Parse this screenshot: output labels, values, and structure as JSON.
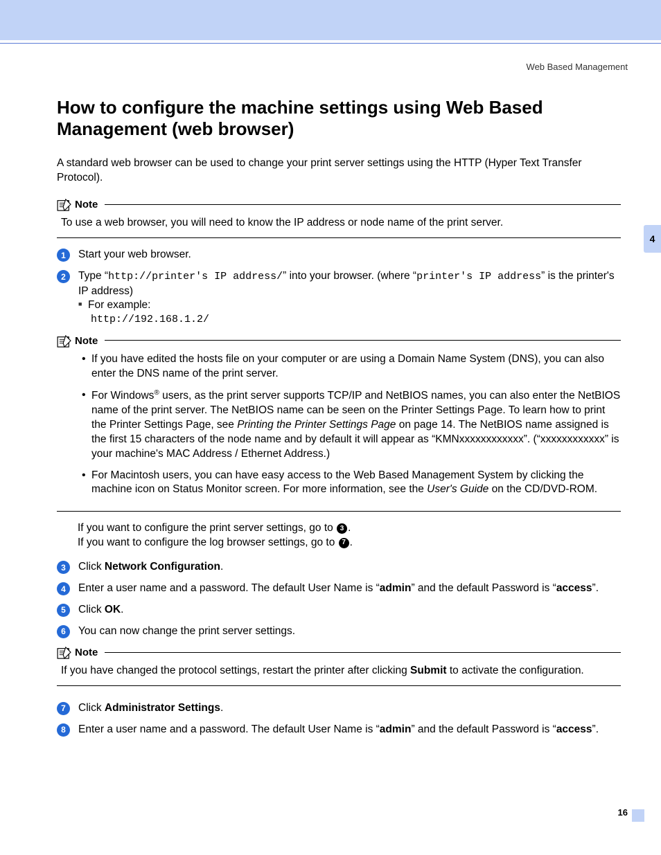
{
  "header_label": "Web Based Management",
  "chapter_tab": "4",
  "page_number": "16",
  "title": "How to configure the machine settings using Web Based Management (web browser)",
  "intro": "A standard web browser can be used to change your print server settings using the HTTP (Hyper Text Transfer Protocol).",
  "note_label": "Note",
  "note1": "To use a web browser, you will need to know the IP address or node name of the print server.",
  "step1": "Start your web browser.",
  "step2_a": "Type “",
  "step2_code1": "http://printer's IP address/",
  "step2_b": "” into your browser. (where “",
  "step2_code2": "printer's IP address",
  "step2_c": "” is the printer's IP address)",
  "step2_example_label": "For example:",
  "step2_example_code": "http://192.168.1.2/",
  "note2_b1": "If you have edited the hosts file on your computer or are using a Domain Name System (DNS), you can also enter the DNS name of the print server.",
  "note2_b2_a": "For Windows",
  "note2_b2_b": " users, as the print server supports TCP/IP and NetBIOS names, you can also enter the NetBIOS name of the print server. The NetBIOS name can be seen on the Printer Settings Page. To learn how to print the Printer Settings Page, see ",
  "note2_b2_italic": "Printing the Printer Settings Page",
  "note2_b2_c": " on page 14. The NetBIOS name assigned is the first 15 characters of the node name and by default it will appear as “KMNxxxxxxxxxxxx”. (“xxxxxxxxxxxx” is your machine's MAC Address / Ethernet Address.)",
  "note2_b3_a": "For Macintosh users, you can have easy access to the Web Based Management System by clicking the machine icon on Status Monitor screen. For more information, see the ",
  "note2_b3_italic": "User's Guide",
  "note2_b3_b": " on the CD/DVD-ROM.",
  "goto_a": "If you want to configure the print server settings, go to ",
  "goto_a_num": "3",
  "goto_b": "If you want to configure the log browser settings, go to ",
  "goto_b_num": "7",
  "step3_a": "Click ",
  "step3_bold": "Network Configuration",
  "step4_a": "Enter a user name and a password. The default User Name is “",
  "step4_bold1": "admin",
  "step4_b": "” and the default Password is “",
  "step4_bold2": "access",
  "step4_c": "”.",
  "step5_a": "Click ",
  "step5_bold": "OK",
  "step6": "You can now change the print server settings.",
  "note3_a": "If you have changed the protocol settings, restart the printer after clicking ",
  "note3_bold": "Submit",
  "note3_b": " to activate the configuration.",
  "step7_a": "Click ",
  "step7_bold": "Administrator Settings",
  "step8_a": "Enter a user name and a password. The default User Name is “",
  "step8_bold1": "admin",
  "step8_b": "” and the default Password is “",
  "step8_bold2": "access",
  "step8_c": "”."
}
